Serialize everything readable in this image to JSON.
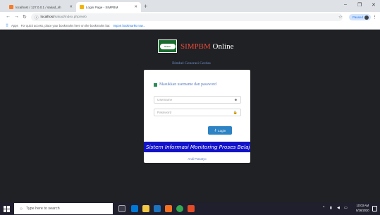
{
  "browser": {
    "tabs": [
      {
        "title": "localhost / 127.0.0.1 / sakad_sh",
        "icon": "xampp-favicon-icon"
      },
      {
        "title": "Login Page - SIMPBM",
        "icon": "simpbm-favicon-icon"
      }
    ],
    "url_host": "localhost",
    "url_path": "/sakad/index.php/web",
    "profile_label": "Paused",
    "bookmarks_apps": "Apps",
    "bookmarks_hint": "For quick access, place your bookmarks here on the bookmarks bar.",
    "bookmarks_import": "Import bookmarks now..."
  },
  "page": {
    "brand_prefix": "SIMPBM",
    "brand_suffix": " Online",
    "logo_text": "Green",
    "subtitle": "Bimbel Generasi Cerdas",
    "login_header": "Masukkan username dan password",
    "username_placeholder": "Username",
    "password_placeholder": "Password",
    "login_button": "Login",
    "marquee_text": "Sistem Informasi Monitoring Proses Belajar",
    "footer_link": "Andi Prasetyo"
  },
  "taskbar": {
    "search_placeholder": "Type here to search",
    "time": "10:03 AM",
    "date": "5/26/2020"
  },
  "colors": {
    "page_bg": "#202124",
    "brand_accent": "#e64b3b",
    "subtitle_blue": "#6d8ec9",
    "button_blue": "#2d83c4",
    "marquee_blue": "#1212c9"
  }
}
